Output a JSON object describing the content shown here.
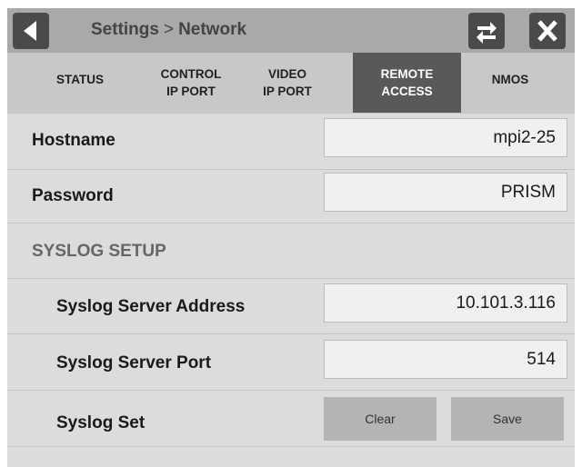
{
  "header": {
    "breadcrumb_parent": "Settings",
    "breadcrumb_sep": ">",
    "breadcrumb_current": "Network"
  },
  "tabs": [
    {
      "line1": "STATUS",
      "line2": ""
    },
    {
      "line1": "CONTROL",
      "line2": "IP PORT"
    },
    {
      "line1": "VIDEO",
      "line2": "IP PORT"
    },
    {
      "line1": "REMOTE",
      "line2": "ACCESS"
    },
    {
      "line1": "NMOS",
      "line2": ""
    }
  ],
  "active_tab": "REMOTE ACCESS",
  "form": {
    "hostname_label": "Hostname",
    "hostname_value": "mpi2-25",
    "password_label": "Password",
    "password_value": "PRISM",
    "syslog_section": "SYSLOG SETUP",
    "syslog_address_label": "Syslog Server Address",
    "syslog_address_value": "10.101.3.116",
    "syslog_port_label": "Syslog Server Port",
    "syslog_port_value": "514",
    "syslog_set_label": "Syslog Set",
    "clear_label": "Clear",
    "save_label": "Save"
  },
  "icons": {
    "back": "back-arrow-icon",
    "swap": "swap-arrows-icon",
    "close": "close-x-icon"
  },
  "colors": {
    "header_bg": "#a9a9a9",
    "active_tab_bg": "#595959",
    "icon_bg": "#4a4a4a"
  }
}
